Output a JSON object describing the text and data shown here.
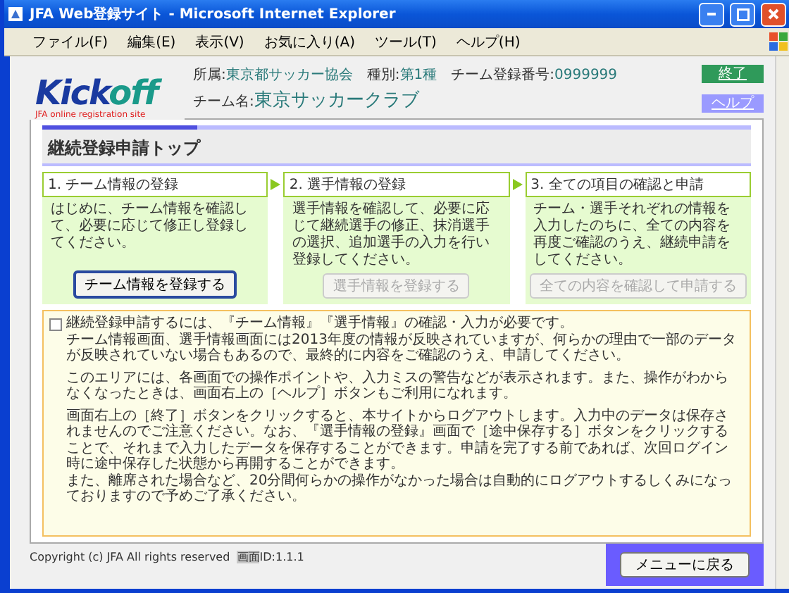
{
  "window": {
    "title": "JFA Web登録サイト - Microsoft Internet Explorer",
    "menu": [
      "ファイル(F)",
      "編集(E)",
      "表示(V)",
      "お気に入り(A)",
      "ツール(T)",
      "ヘルプ(H)"
    ]
  },
  "logo": {
    "word_start": "Kick",
    "word_end": "off",
    "tagline": "JFA online registration site"
  },
  "header": {
    "fields": [
      {
        "label": "所属:",
        "value": "東京都サッカー協会"
      },
      {
        "label": "種別:",
        "value": "第1種"
      },
      {
        "label": "チーム登録番号:",
        "value": "0999999"
      }
    ],
    "team_name": {
      "label": "チーム名:",
      "value": "東京サッカークラブ"
    },
    "buttons": [
      {
        "label": "終了",
        "kind": "exit"
      },
      {
        "label": "ヘルプ",
        "kind": "help"
      }
    ]
  },
  "page_title": "継続登録申請トップ",
  "steps": [
    {
      "title": "1. チーム情報の登録",
      "text": "はじめに、チーム情報を確認して、必要に応じて修正し登録してください。",
      "button": {
        "label": "チーム情報を登録する",
        "disabled": false
      }
    },
    {
      "title": "2. 選手情報の登録",
      "text": "選手情報を確認して、必要に応じて継続選手の修正、抹消選手の選択、追加選手の入力を行い登録してください。",
      "button": {
        "label": "選手情報を登録する",
        "disabled": true
      }
    },
    {
      "title": "3. 全ての項目の確認と申請",
      "text": "チーム・選手それぞれの情報を入力したのちに、全ての内容を再度ご確認のうえ、継続申請をしてください。",
      "button": {
        "label": "全ての内容を確認して申請する",
        "disabled": true
      }
    }
  ],
  "notice": {
    "paragraphs": [
      [
        "継続登録申請するには、『チーム情報』『選手情報』の確認・入力が必要です。",
        "チーム情報画面、選手情報画面には2013年度の情報が反映されていますが、何らかの理由で一部のデータが反映されていない場合もあるので、最終的に内容をご確認のうえ、申請してください。"
      ],
      [
        "このエリアには、各画面での操作ポイントや、入力ミスの警告などが表示されます。また、操作がわからなくなったときは、画面右上の［ヘルプ］ボタンもご利用になれます。"
      ],
      [
        "画面右上の［終了］ボタンをクリックすると、本サイトからログアウトします。入力中のデータは保存されませんのでご注意ください。なお、『選手情報の登録』画面で［途中保存する］ボタンをクリックすることで、それまで入力したデータを保存することができます。申請を完了する前であれば、次回ログイン時に途中保存した状態から再開することができます。",
        "また、離席された場合など、20分間何らかの操作がなかった場合は自動的にログアウトするしくみになっておりますので予めご了承ください。"
      ]
    ]
  },
  "footer": {
    "copyright": "Copyright (c) JFA All rights reserved",
    "screen_label": "画面",
    "screen_id": "ID:1.1.1",
    "back_button": "メニューに戻る"
  }
}
